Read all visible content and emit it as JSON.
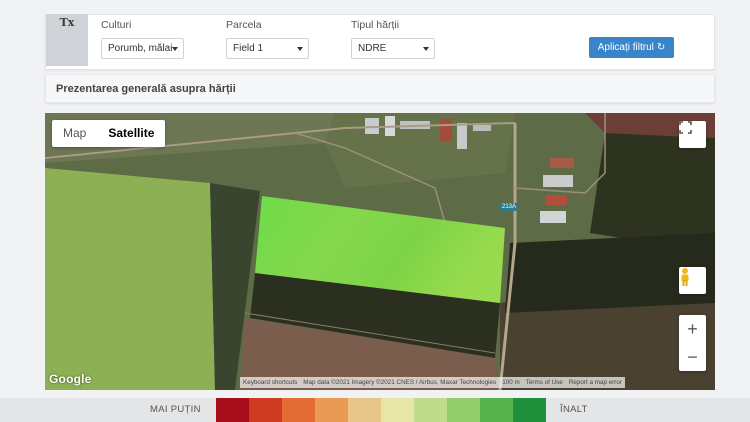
{
  "logo": {
    "text": "Tx"
  },
  "filters": {
    "crops": {
      "label": "Culturi",
      "value": "Porumb, mălai"
    },
    "parcel": {
      "label": "Parcela",
      "value": "Field 1"
    },
    "map_type": {
      "label": "Tipul hărții",
      "value": "NDRE"
    },
    "apply_label": "Aplicați filtrul",
    "apply_icon": "refresh-icon"
  },
  "section": {
    "title": "Prezentarea generală asupra hărții"
  },
  "map": {
    "type_buttons": [
      {
        "label": "Map",
        "active": false
      },
      {
        "label": "Satellite",
        "active": true
      }
    ],
    "road_label": "213A",
    "google_logo": "Google",
    "attribution": {
      "shortcuts": "Keyboard shortcuts",
      "data": "Map data ©2021 Imagery ©2021 CNES / Airbus, Maxar Technologies",
      "scale": "100 m",
      "terms": "Terms of Use",
      "report": "Report a map error"
    },
    "controls": {
      "zoom_in": "+",
      "zoom_out": "−"
    }
  },
  "legend": {
    "low_label": "MAI PUȚIN",
    "high_label": "ÎNALT",
    "colors": [
      "#a50d1a",
      "#cf3a22",
      "#e36b34",
      "#e99a54",
      "#e8c68a",
      "#e6e6a8",
      "#bfdc8a",
      "#92cc6b",
      "#57b34d",
      "#1f8f3c"
    ]
  }
}
